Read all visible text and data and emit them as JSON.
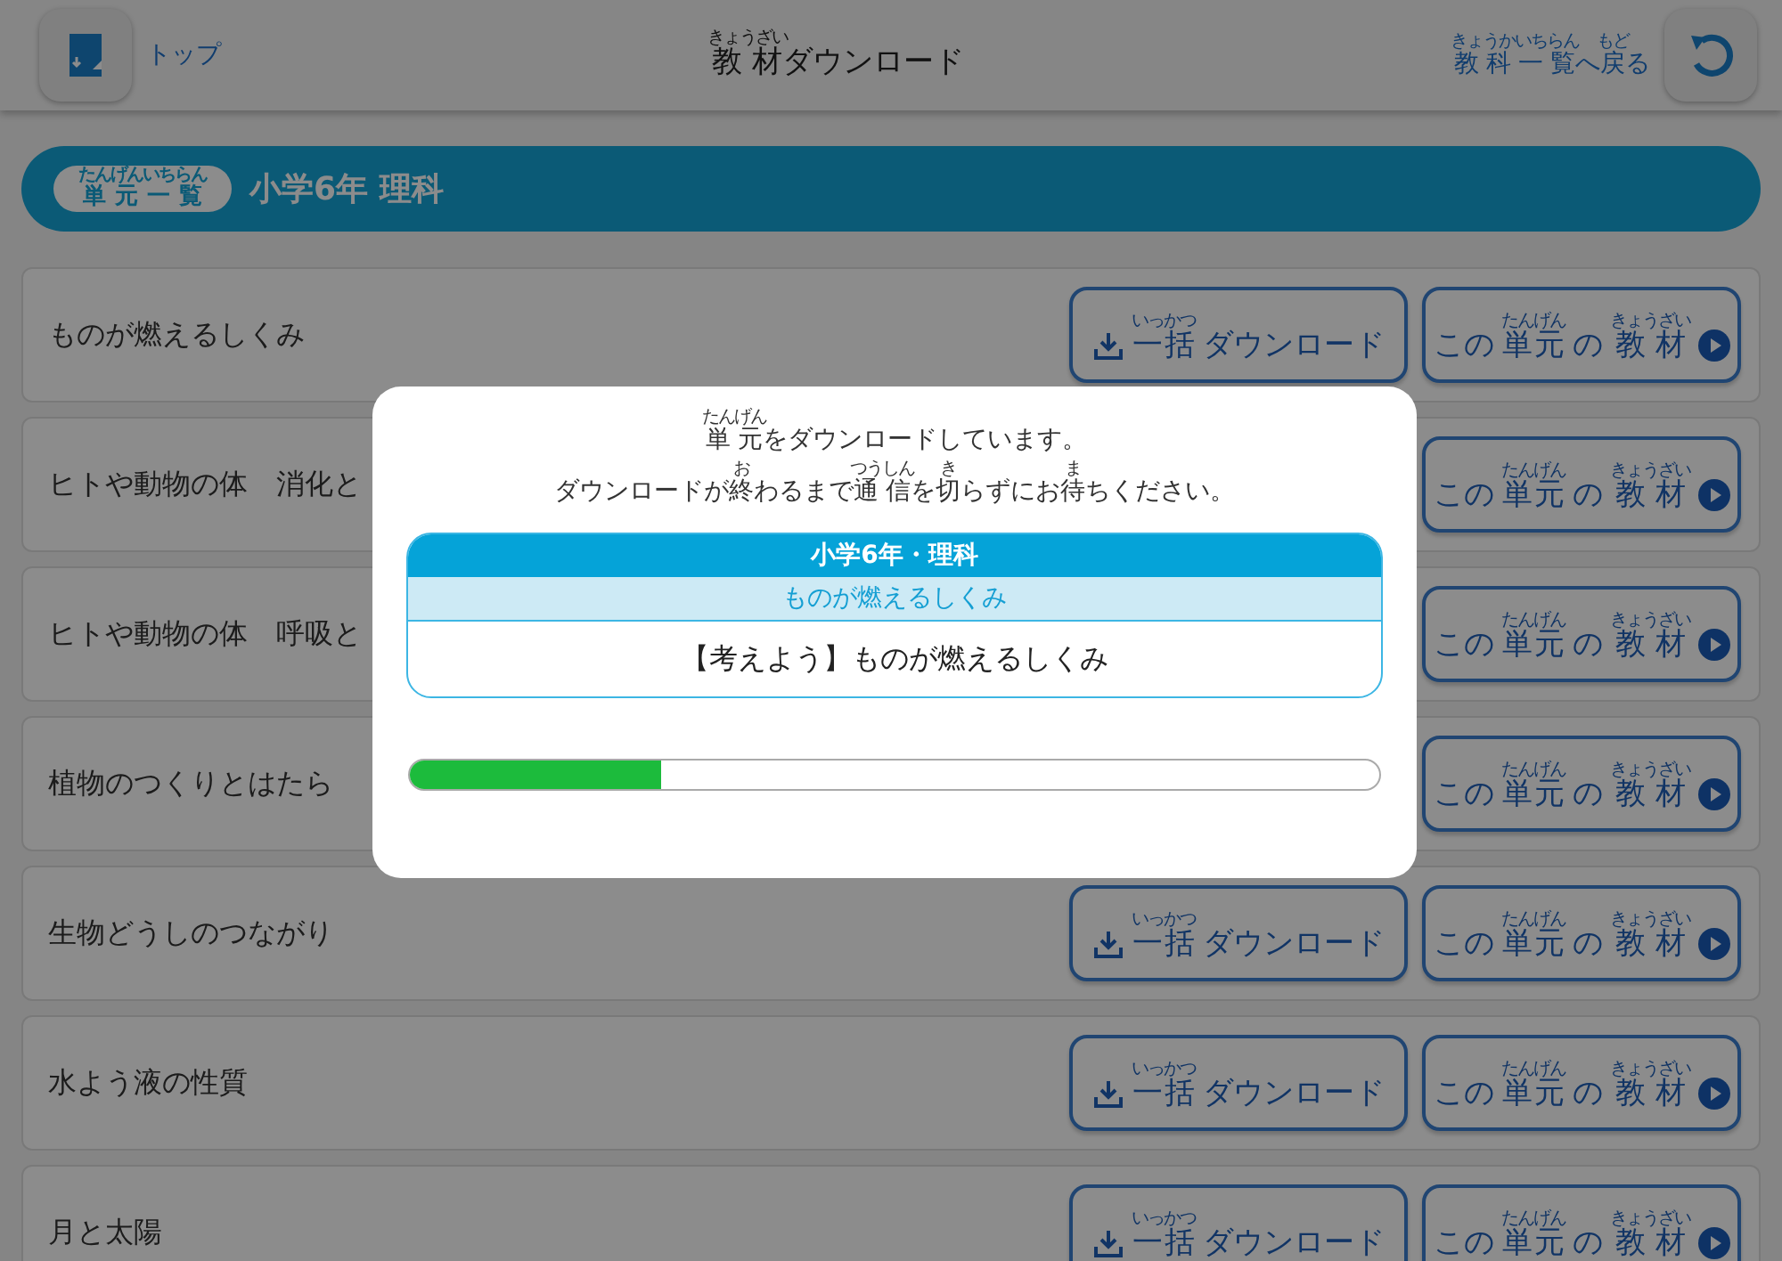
{
  "header": {
    "top_link": "トップ",
    "title": [
      {
        "text": "教材",
        "ruby": "きょうざい"
      },
      {
        "text": "ダウンロード"
      }
    ],
    "back_link": [
      {
        "text": "教科一覧",
        "ruby": "きょうかいちらん"
      },
      {
        "text": "へ"
      },
      {
        "text": "戻",
        "ruby": "もど"
      },
      {
        "text": "る"
      }
    ]
  },
  "banner": {
    "pill": [
      {
        "text": "単元一覧",
        "ruby": "たんげんいちらん"
      }
    ],
    "title": "小学6年 理科"
  },
  "units": [
    {
      "name": "ものが燃えるしくみ",
      "download_button": [
        {
          "text": "一括",
          "ruby": "いっかつ"
        },
        {
          "text": "ダウンロード"
        }
      ],
      "open_button": [
        {
          "text": "この"
        },
        {
          "text": "単元",
          "ruby": "たんげん"
        },
        {
          "text": "の"
        },
        {
          "text": "教材",
          "ruby": "きょうざい"
        }
      ]
    },
    {
      "name": "ヒトや動物の体　消化と",
      "open_button": [
        {
          "text": "この"
        },
        {
          "text": "単元",
          "ruby": "たんげん"
        },
        {
          "text": "の"
        },
        {
          "text": "教材",
          "ruby": "きょうざい"
        }
      ]
    },
    {
      "name": "ヒトや動物の体　呼吸と",
      "open_button": [
        {
          "text": "この"
        },
        {
          "text": "単元",
          "ruby": "たんげん"
        },
        {
          "text": "の"
        },
        {
          "text": "教材",
          "ruby": "きょうざい"
        }
      ]
    },
    {
      "name": "植物のつくりとはたら",
      "open_button": [
        {
          "text": "この"
        },
        {
          "text": "単元",
          "ruby": "たんげん"
        },
        {
          "text": "の"
        },
        {
          "text": "教材",
          "ruby": "きょうざい"
        }
      ]
    },
    {
      "name": "生物どうしのつながり",
      "download_button": [
        {
          "text": "一括",
          "ruby": "いっかつ"
        },
        {
          "text": "ダウンロード"
        }
      ],
      "open_button": [
        {
          "text": "この"
        },
        {
          "text": "単元",
          "ruby": "たんげん"
        },
        {
          "text": "の"
        },
        {
          "text": "教材",
          "ruby": "きょうざい"
        }
      ]
    },
    {
      "name": "水よう液の性質",
      "download_button": [
        {
          "text": "一括",
          "ruby": "いっかつ"
        },
        {
          "text": "ダウンロード"
        }
      ],
      "open_button": [
        {
          "text": "この"
        },
        {
          "text": "単元",
          "ruby": "たんげん"
        },
        {
          "text": "の"
        },
        {
          "text": "教材",
          "ruby": "きょうざい"
        }
      ]
    },
    {
      "name": "月と太陽",
      "download_button": [
        {
          "text": "一括",
          "ruby": "いっかつ"
        },
        {
          "text": "ダウンロード"
        }
      ],
      "open_button": [
        {
          "text": "この"
        },
        {
          "text": "単元",
          "ruby": "たんげん"
        },
        {
          "text": "の"
        },
        {
          "text": "教材",
          "ruby": "きょうざい"
        }
      ]
    }
  ],
  "dialog": {
    "message_lines": [
      [
        {
          "text": "単元",
          "ruby": "たんげん"
        },
        {
          "text": "をダウンロードしています。"
        }
      ],
      [
        {
          "text": "ダウンロードが"
        },
        {
          "text": "終",
          "ruby": "お"
        },
        {
          "text": "わるまで"
        },
        {
          "text": "通信",
          "ruby": "つうしん"
        },
        {
          "text": "を"
        },
        {
          "text": "切",
          "ruby": "き"
        },
        {
          "text": "らずにお"
        },
        {
          "text": "待",
          "ruby": "ま"
        },
        {
          "text": "ちください。"
        }
      ]
    ],
    "grade_subject": "小学6年・理科",
    "unit": "ものが燃えるしくみ",
    "item": "【考えよう】ものが燃えるしくみ",
    "progress": {
      "level": 0.26
    }
  }
}
